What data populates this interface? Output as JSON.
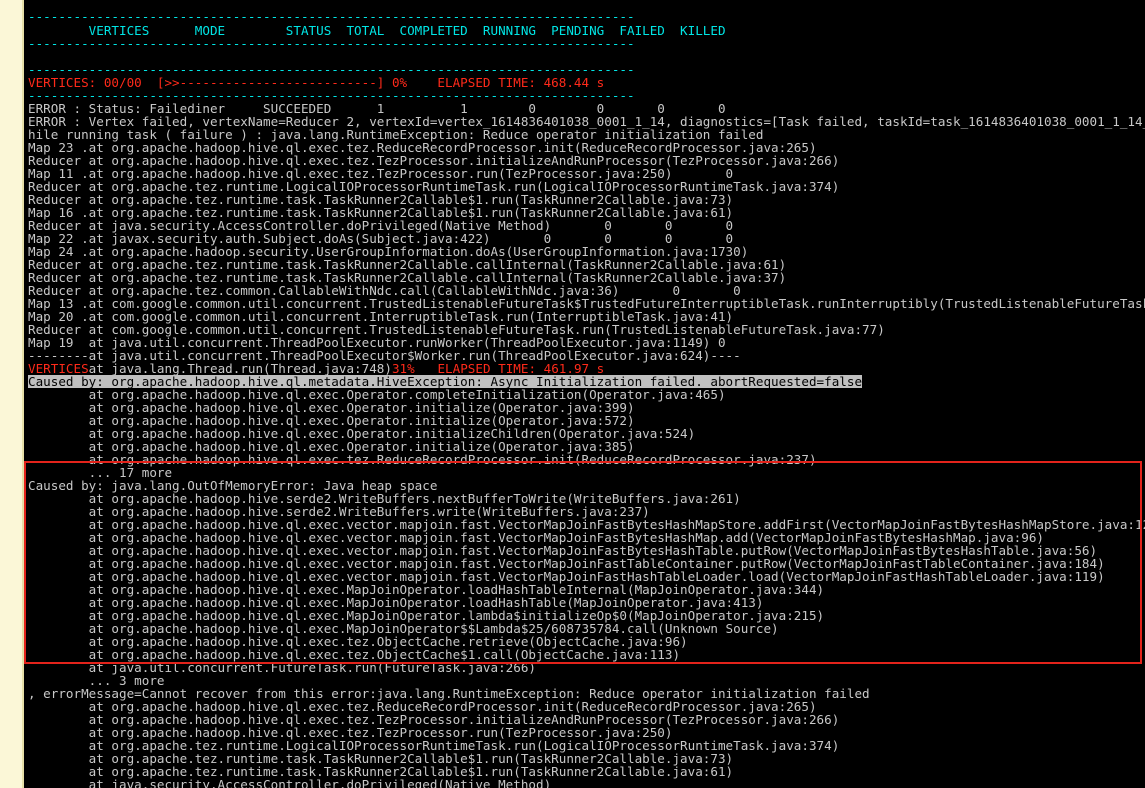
{
  "colors": {
    "background": "#000000",
    "text": "#c8c8c8",
    "header_cyan": "#00e5e5",
    "error_red": "#ff2a1a",
    "highlight": "#c0c0c0",
    "annotation_box": "#e3231b",
    "left_bar": "#fbf7d7"
  },
  "rule_line": "--------------------------------------------------------------------------------",
  "vertices_header": "        VERTICES      MODE        STATUS  TOTAL  COMPLETED  RUNNING  PENDING  FAILED  KILLED",
  "progress_line": "VERTICES: 00/00  [>>--------------------------] 0%    ELAPSED TIME: 468.44 s",
  "error_status_line": "ERROR : Status: Failediner     SUCCEEDED      1          1        0        0       0       0",
  "error_vertex_line": "ERROR : Vertex failed, vertexName=Reducer 2, vertexId=vertex_1614836401038_0001_1_14, diagnostics=[Task failed, taskId=task_1614836401038_0001_1_14_000000, diagnostics=[TaskAttempt 0 failed, info=[Error: Error w",
  "lines_block1": [
    "hile running task ( failure ) : java.lang.RuntimeException: Reduce operator initialization failed",
    "Map 23 .at org.apache.hadoop.hive.ql.exec.tez.ReduceRecordProcessor.init(ReduceRecordProcessor.java:265)",
    "Reducer at org.apache.hadoop.hive.ql.exec.tez.TezProcessor.initializeAndRunProcessor(TezProcessor.java:266)",
    "Map 11 .at org.apache.hadoop.hive.ql.exec.tez.TezProcessor.run(TezProcessor.java:250)       0",
    "Reducer at org.apache.tez.runtime.LogicalIOProcessorRuntimeTask.run(LogicalIOProcessorRuntimeTask.java:374)",
    "Reducer at org.apache.tez.runtime.task.TaskRunner2Callable$1.run(TaskRunner2Callable.java:73)",
    "Map 16 .at org.apache.tez.runtime.task.TaskRunner2Callable$1.run(TaskRunner2Callable.java:61)",
    "Reducer at java.security.AccessController.doPrivileged(Native Method)       0       0       0",
    "Map 22 .at javax.security.auth.Subject.doAs(Subject.java:422)       0       0       0       0",
    "Map 24 .at org.apache.hadoop.security.UserGroupInformation.doAs(UserGroupInformation.java:1730)",
    "Reducer at org.apache.tez.runtime.task.TaskRunner2Callable.callInternal(TaskRunner2Callable.java:61)",
    "Reducer at org.apache.tez.runtime.task.TaskRunner2Callable.callInternal(TaskRunner2Callable.java:37)",
    "Reducer at org.apache.tez.common.CallableWithNdc.call(CallableWithNdc.java:36)       0       0",
    "Map 13 .at com.google.common.util.concurrent.TrustedListenableFutureTask$TrustedFutureInterruptibleTask.runInterruptibly(TrustedListenableFutureTask.java:108)",
    "Map 20 .at com.google.common.util.concurrent.InterruptibleTask.run(InterruptibleTask.java:41)",
    "Reducer at com.google.common.util.concurrent.TrustedListenableFutureTask.run(TrustedListenableFutureTask.java:77)",
    "Map 19  at java.util.concurrent.ThreadPoolExecutor.runWorker(ThreadPoolExecutor.java:1149) 0",
    "--------at java.util.concurrent.ThreadPoolExecutor$Worker.run(ThreadPoolExecutor.java:624)----"
  ],
  "vertices_mixed": {
    "red_prefix": "VERTICES",
    "middle": "at java.lang.Thread.run(Thread.java:748)",
    "red_suffix": "31%   ELAPSED TIME: 461.97 s"
  },
  "caused_by_highlight": "Caused by: org.apache.hadoop.hive.ql.metadata.HiveException: Async Initialization failed. abortRequested=false",
  "lines_block2": [
    "        at org.apache.hadoop.hive.ql.exec.Operator.completeInitialization(Operator.java:465)",
    "        at org.apache.hadoop.hive.ql.exec.Operator.initialize(Operator.java:399)",
    "        at org.apache.hadoop.hive.ql.exec.Operator.initialize(Operator.java:572)",
    "        at org.apache.hadoop.hive.ql.exec.Operator.initializeChildren(Operator.java:524)",
    "        at org.apache.hadoop.hive.ql.exec.Operator.initialize(Operator.java:385)",
    "        at org.apache.hadoop.hive.ql.exec.tez.ReduceRecordProcessor.init(ReduceRecordProcessor.java:237)",
    "        ... 17 more",
    "Caused by: java.lang.OutOfMemoryError: Java heap space",
    "        at org.apache.hadoop.hive.serde2.WriteBuffers.nextBufferToWrite(WriteBuffers.java:261)",
    "        at org.apache.hadoop.hive.serde2.WriteBuffers.write(WriteBuffers.java:237)",
    "        at org.apache.hadoop.hive.ql.exec.vector.mapjoin.fast.VectorMapJoinFastBytesHashMapStore.addFirst(VectorMapJoinFastBytesHashMapStore.java:123)",
    "        at org.apache.hadoop.hive.ql.exec.vector.mapjoin.fast.VectorMapJoinFastBytesHashMap.add(VectorMapJoinFastBytesHashMap.java:96)",
    "        at org.apache.hadoop.hive.ql.exec.vector.mapjoin.fast.VectorMapJoinFastBytesHashTable.putRow(VectorMapJoinFastBytesHashTable.java:56)",
    "        at org.apache.hadoop.hive.ql.exec.vector.mapjoin.fast.VectorMapJoinFastTableContainer.putRow(VectorMapJoinFastTableContainer.java:184)",
    "        at org.apache.hadoop.hive.ql.exec.vector.mapjoin.fast.VectorMapJoinFastHashTableLoader.load(VectorMapJoinFastHashTableLoader.java:119)",
    "        at org.apache.hadoop.hive.ql.exec.MapJoinOperator.loadHashTableInternal(MapJoinOperator.java:344)",
    "        at org.apache.hadoop.hive.ql.exec.MapJoinOperator.loadHashTable(MapJoinOperator.java:413)",
    "        at org.apache.hadoop.hive.ql.exec.MapJoinOperator.lambda$initializeOp$0(MapJoinOperator.java:215)",
    "        at org.apache.hadoop.hive.ql.exec.MapJoinOperator$$Lambda$25/608735784.call(Unknown Source)",
    "        at org.apache.hadoop.hive.ql.exec.tez.ObjectCache.retrieve(ObjectCache.java:96)",
    "        at org.apache.hadoop.hive.ql.exec.tez.ObjectCache$1.call(ObjectCache.java:113)",
    "        at java.util.concurrent.FutureTask.run(FutureTask.java:266)",
    "        ... 3 more",
    ", errorMessage=Cannot recover from this error:java.lang.RuntimeException: Reduce operator initialization failed",
    "        at org.apache.hadoop.hive.ql.exec.tez.ReduceRecordProcessor.init(ReduceRecordProcessor.java:265)",
    "        at org.apache.hadoop.hive.ql.exec.tez.TezProcessor.initializeAndRunProcessor(TezProcessor.java:266)",
    "        at org.apache.hadoop.hive.ql.exec.tez.TezProcessor.run(TezProcessor.java:250)",
    "        at org.apache.tez.runtime.LogicalIOProcessorRuntimeTask.run(LogicalIOProcessorRuntimeTask.java:374)",
    "        at org.apache.tez.runtime.task.TaskRunner2Callable$1.run(TaskRunner2Callable.java:73)",
    "        at org.apache.tez.runtime.task.TaskRunner2Callable$1.run(TaskRunner2Callable.java:61)",
    "        at java.security.AccessController.doPrivileged(Native Method)"
  ]
}
